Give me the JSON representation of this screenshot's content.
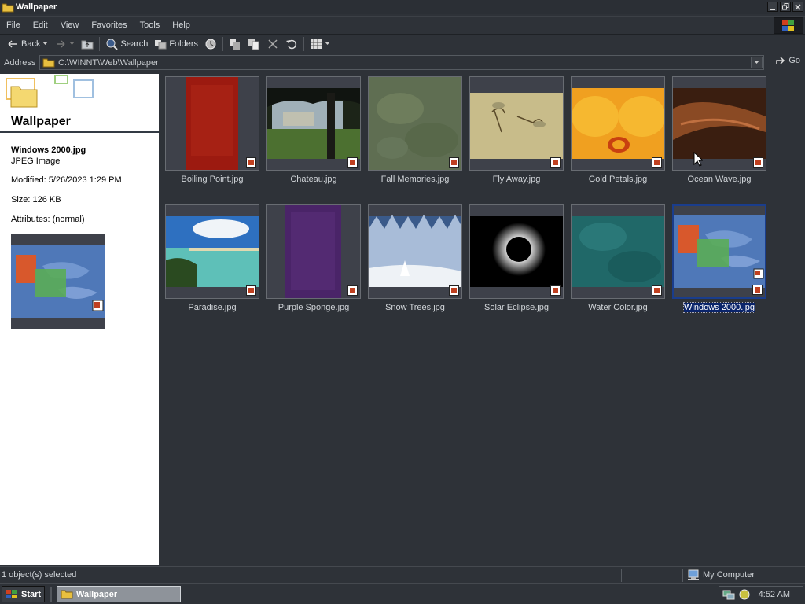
{
  "window": {
    "title": "Wallpaper"
  },
  "menu": [
    "File",
    "Edit",
    "View",
    "Favorites",
    "Tools",
    "Help"
  ],
  "toolbar": {
    "back": "Back",
    "search": "Search",
    "folders": "Folders"
  },
  "address": {
    "label": "Address",
    "path": "C:\\WINNT\\Web\\Wallpaper",
    "go": "Go"
  },
  "left_pane": {
    "folder_title": "Wallpaper",
    "selected_name": "Windows 2000.jpg",
    "selected_type": "JPEG Image",
    "modified": "Modified: 5/26/2023 1:29 PM",
    "size": "Size: 126 KB",
    "attributes": "Attributes: (normal)"
  },
  "files": [
    {
      "name": "Boiling Point.jpg",
      "icon": "red-texture-thumbnail"
    },
    {
      "name": "Chateau.jpg",
      "icon": "chateau-photo-thumbnail"
    },
    {
      "name": "Fall Memories.jpg",
      "icon": "green-leaves-thumbnail"
    },
    {
      "name": "Fly Away.jpg",
      "icon": "dragonflies-thumbnail"
    },
    {
      "name": "Gold Petals.jpg",
      "icon": "gold-flower-thumbnail"
    },
    {
      "name": "Ocean Wave.jpg",
      "icon": "sunset-clouds-thumbnail"
    },
    {
      "name": "Paradise.jpg",
      "icon": "beach-thumbnail"
    },
    {
      "name": "Purple Sponge.jpg",
      "icon": "purple-texture-thumbnail"
    },
    {
      "name": "Snow Trees.jpg",
      "icon": "snow-forest-thumbnail"
    },
    {
      "name": "Solar Eclipse.jpg",
      "icon": "eclipse-thumbnail"
    },
    {
      "name": "Water Color.jpg",
      "icon": "teal-texture-thumbnail"
    },
    {
      "name": "Windows 2000.jpg",
      "icon": "windows-2000-thumbnail",
      "selected": true
    }
  ],
  "status": {
    "selection": "1 object(s) selected",
    "zone": "My Computer"
  },
  "taskbar": {
    "start": "Start",
    "task": "Wallpaper",
    "clock": "4:52 AM"
  },
  "colors": {
    "selection": "#0a246a",
    "bg": "#2e3238"
  }
}
